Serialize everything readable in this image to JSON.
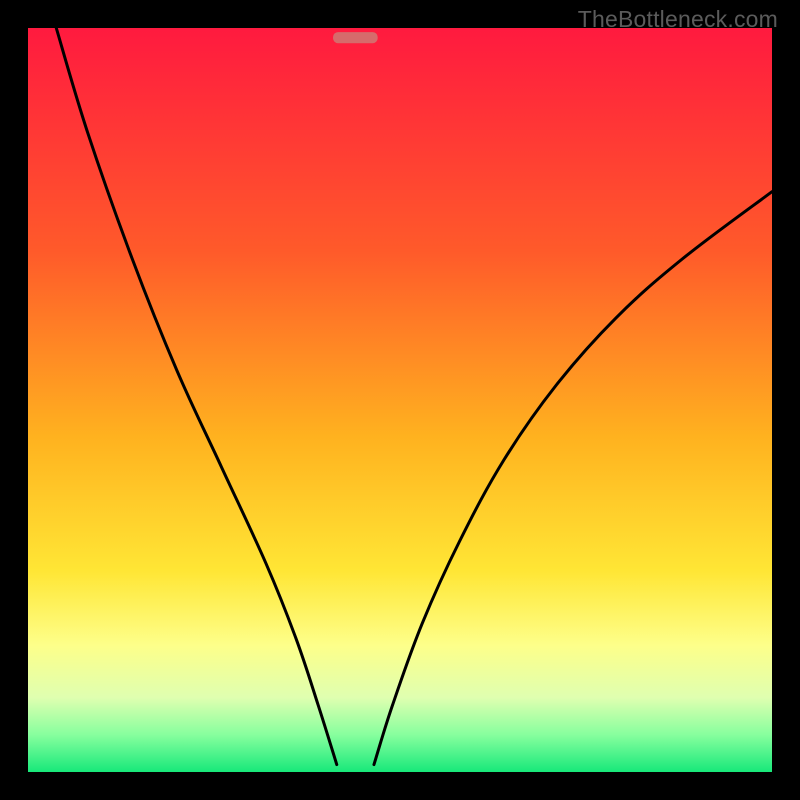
{
  "watermark": "TheBottleneck.com",
  "chart_data": {
    "type": "line",
    "title": "",
    "xlabel": "",
    "ylabel": "",
    "xlim": [
      0,
      100
    ],
    "ylim": [
      0,
      100
    ],
    "grid": false,
    "background_gradient": {
      "stops": [
        {
          "offset": 0.0,
          "color": "#ff1a3f"
        },
        {
          "offset": 0.3,
          "color": "#ff5a2a"
        },
        {
          "offset": 0.55,
          "color": "#ffb21f"
        },
        {
          "offset": 0.73,
          "color": "#ffe635"
        },
        {
          "offset": 0.83,
          "color": "#fdff8a"
        },
        {
          "offset": 0.9,
          "color": "#dfffb0"
        },
        {
          "offset": 0.95,
          "color": "#87ff9e"
        },
        {
          "offset": 1.0,
          "color": "#17e87a"
        }
      ]
    },
    "marker": {
      "x": 44,
      "y": 98.7,
      "width": 6,
      "height": 1.5,
      "color": "#d66b6b"
    },
    "series": [
      {
        "name": "left-curve",
        "x": [
          3.8,
          8,
          14,
          20,
          26,
          32,
          36,
          39,
          41.5
        ],
        "y": [
          100,
          86,
          69,
          54,
          41,
          28,
          18,
          9,
          1
        ]
      },
      {
        "name": "right-curve",
        "x": [
          46.5,
          49,
          53,
          58,
          64,
          71,
          79,
          88,
          100
        ],
        "y": [
          1,
          9,
          20,
          31,
          42,
          52,
          61,
          69,
          78
        ]
      }
    ]
  }
}
